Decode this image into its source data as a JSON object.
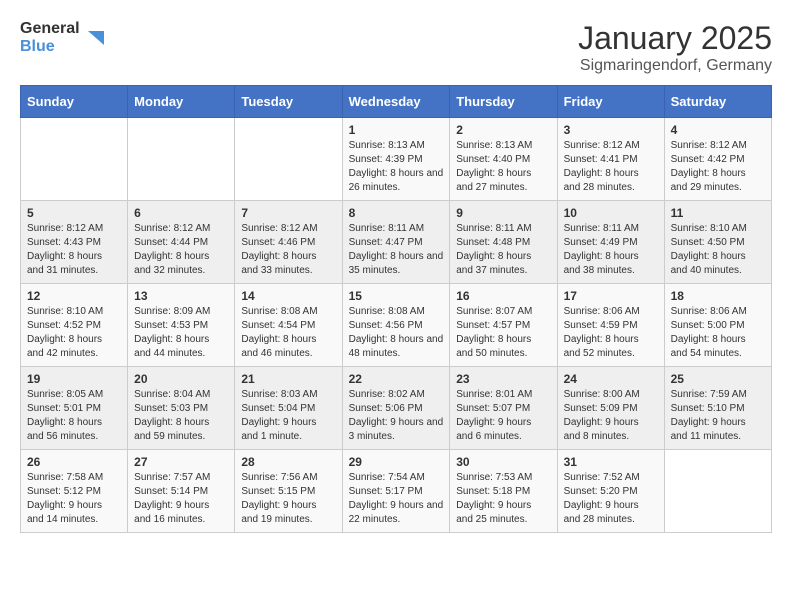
{
  "header": {
    "logo_general": "General",
    "logo_blue": "Blue",
    "month": "January 2025",
    "location": "Sigmaringendorf, Germany"
  },
  "weekdays": [
    "Sunday",
    "Monday",
    "Tuesday",
    "Wednesday",
    "Thursday",
    "Friday",
    "Saturday"
  ],
  "weeks": [
    [
      {
        "day": "",
        "info": ""
      },
      {
        "day": "",
        "info": ""
      },
      {
        "day": "",
        "info": ""
      },
      {
        "day": "1",
        "info": "Sunrise: 8:13 AM\nSunset: 4:39 PM\nDaylight: 8 hours and 26 minutes."
      },
      {
        "day": "2",
        "info": "Sunrise: 8:13 AM\nSunset: 4:40 PM\nDaylight: 8 hours and 27 minutes."
      },
      {
        "day": "3",
        "info": "Sunrise: 8:12 AM\nSunset: 4:41 PM\nDaylight: 8 hours and 28 minutes."
      },
      {
        "day": "4",
        "info": "Sunrise: 8:12 AM\nSunset: 4:42 PM\nDaylight: 8 hours and 29 minutes."
      }
    ],
    [
      {
        "day": "5",
        "info": "Sunrise: 8:12 AM\nSunset: 4:43 PM\nDaylight: 8 hours and 31 minutes."
      },
      {
        "day": "6",
        "info": "Sunrise: 8:12 AM\nSunset: 4:44 PM\nDaylight: 8 hours and 32 minutes."
      },
      {
        "day": "7",
        "info": "Sunrise: 8:12 AM\nSunset: 4:46 PM\nDaylight: 8 hours and 33 minutes."
      },
      {
        "day": "8",
        "info": "Sunrise: 8:11 AM\nSunset: 4:47 PM\nDaylight: 8 hours and 35 minutes."
      },
      {
        "day": "9",
        "info": "Sunrise: 8:11 AM\nSunset: 4:48 PM\nDaylight: 8 hours and 37 minutes."
      },
      {
        "day": "10",
        "info": "Sunrise: 8:11 AM\nSunset: 4:49 PM\nDaylight: 8 hours and 38 minutes."
      },
      {
        "day": "11",
        "info": "Sunrise: 8:10 AM\nSunset: 4:50 PM\nDaylight: 8 hours and 40 minutes."
      }
    ],
    [
      {
        "day": "12",
        "info": "Sunrise: 8:10 AM\nSunset: 4:52 PM\nDaylight: 8 hours and 42 minutes."
      },
      {
        "day": "13",
        "info": "Sunrise: 8:09 AM\nSunset: 4:53 PM\nDaylight: 8 hours and 44 minutes."
      },
      {
        "day": "14",
        "info": "Sunrise: 8:08 AM\nSunset: 4:54 PM\nDaylight: 8 hours and 46 minutes."
      },
      {
        "day": "15",
        "info": "Sunrise: 8:08 AM\nSunset: 4:56 PM\nDaylight: 8 hours and 48 minutes."
      },
      {
        "day": "16",
        "info": "Sunrise: 8:07 AM\nSunset: 4:57 PM\nDaylight: 8 hours and 50 minutes."
      },
      {
        "day": "17",
        "info": "Sunrise: 8:06 AM\nSunset: 4:59 PM\nDaylight: 8 hours and 52 minutes."
      },
      {
        "day": "18",
        "info": "Sunrise: 8:06 AM\nSunset: 5:00 PM\nDaylight: 8 hours and 54 minutes."
      }
    ],
    [
      {
        "day": "19",
        "info": "Sunrise: 8:05 AM\nSunset: 5:01 PM\nDaylight: 8 hours and 56 minutes."
      },
      {
        "day": "20",
        "info": "Sunrise: 8:04 AM\nSunset: 5:03 PM\nDaylight: 8 hours and 59 minutes."
      },
      {
        "day": "21",
        "info": "Sunrise: 8:03 AM\nSunset: 5:04 PM\nDaylight: 9 hours and 1 minute."
      },
      {
        "day": "22",
        "info": "Sunrise: 8:02 AM\nSunset: 5:06 PM\nDaylight: 9 hours and 3 minutes."
      },
      {
        "day": "23",
        "info": "Sunrise: 8:01 AM\nSunset: 5:07 PM\nDaylight: 9 hours and 6 minutes."
      },
      {
        "day": "24",
        "info": "Sunrise: 8:00 AM\nSunset: 5:09 PM\nDaylight: 9 hours and 8 minutes."
      },
      {
        "day": "25",
        "info": "Sunrise: 7:59 AM\nSunset: 5:10 PM\nDaylight: 9 hours and 11 minutes."
      }
    ],
    [
      {
        "day": "26",
        "info": "Sunrise: 7:58 AM\nSunset: 5:12 PM\nDaylight: 9 hours and 14 minutes."
      },
      {
        "day": "27",
        "info": "Sunrise: 7:57 AM\nSunset: 5:14 PM\nDaylight: 9 hours and 16 minutes."
      },
      {
        "day": "28",
        "info": "Sunrise: 7:56 AM\nSunset: 5:15 PM\nDaylight: 9 hours and 19 minutes."
      },
      {
        "day": "29",
        "info": "Sunrise: 7:54 AM\nSunset: 5:17 PM\nDaylight: 9 hours and 22 minutes."
      },
      {
        "day": "30",
        "info": "Sunrise: 7:53 AM\nSunset: 5:18 PM\nDaylight: 9 hours and 25 minutes."
      },
      {
        "day": "31",
        "info": "Sunrise: 7:52 AM\nSunset: 5:20 PM\nDaylight: 9 hours and 28 minutes."
      },
      {
        "day": "",
        "info": ""
      }
    ]
  ]
}
